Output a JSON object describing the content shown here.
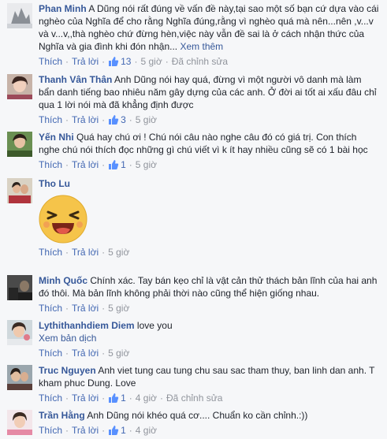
{
  "comments": [
    {
      "author": "Phan Minh",
      "text": "A Dũng nói rất đúng về vấn đề này,tại sao một số bạn cứ dựa vào cái nghèo của Nghĩa để cho rằng Nghĩa đúng,rằng vì nghèo quá mà nên...nên ,v...v và v...v,,thà nghèo chứ đừng hèn,việc này vẫn đề sai là ở cách nhận thức của Nghĩa và gia đình khi đón nhận...",
      "see_more": "Xem thêm",
      "like": "Thích",
      "reply": "Trả lời",
      "likes": "13",
      "time": "5 giờ",
      "edited": "Đã chỉnh sửa"
    },
    {
      "author": "Thanh Vân Thân",
      "text": "Anh Dũng nói hay quá, đừng vì một người vô danh mà làm bẩn danh tiếng bao nhiêu năm gây dựng của các anh. Ở đời ai tốt ai xấu đâu chỉ qua 1 lời nói mà đã khẳng định được",
      "like": "Thích",
      "reply": "Trả lời",
      "likes": "3",
      "time": "5 giờ"
    },
    {
      "author": "Yến Nhi",
      "text": "Quá hay chú ơi ! Chú nói câu nào nghe câu đó có giá trị. Con thích nghe chú nói thích đọc những gì chú viết vì k ít hay nhiều cũng sẽ có 1 bài học",
      "like": "Thích",
      "reply": "Trả lời",
      "likes": "1",
      "time": "5 giờ"
    },
    {
      "author": "Tho Lu",
      "text": "",
      "sticker": "laughing-face-sticker",
      "like": "Thích",
      "reply": "Trả lời",
      "time": "5 giờ"
    },
    {
      "author": "Minh Quốc",
      "text": "Chính xác. Tay bán kẹo chỉ là vật cản thử thách bản lĩnh của hai anh đó thôi. Mà bản lĩnh không phải thời nào cũng thể hiện giống nhau.",
      "like": "Thích",
      "reply": "Trả lời",
      "time": "5 giờ"
    },
    {
      "author": "Lythithanhdiem Diem",
      "text": "love you",
      "translate": "Xem bản dịch",
      "like": "Thích",
      "reply": "Trả lời",
      "time": "5 giờ"
    },
    {
      "author": "Truc Nguyen",
      "text": "Anh viet tung cau tung chu sau sac tham thuy, ban linh dan anh. T kham phuc Dung. Love",
      "like": "Thích",
      "reply": "Trả lời",
      "likes": "1",
      "time": "4 giờ",
      "edited": "Đã chỉnh sửa"
    },
    {
      "author": "Trần Hằng",
      "text": "Anh Dũng nói khéo quá cơ.... Chuẩn ko cần chỉnh.:))",
      "like": "Thích",
      "reply": "Trả lời",
      "likes": "1",
      "time": "4 giờ"
    }
  ],
  "colors": {
    "author": "#365899",
    "link": "#4267b2",
    "meta": "#90949c",
    "text": "#1d2129",
    "background": "#f6f7f9",
    "sticker": "#f5c44a"
  }
}
